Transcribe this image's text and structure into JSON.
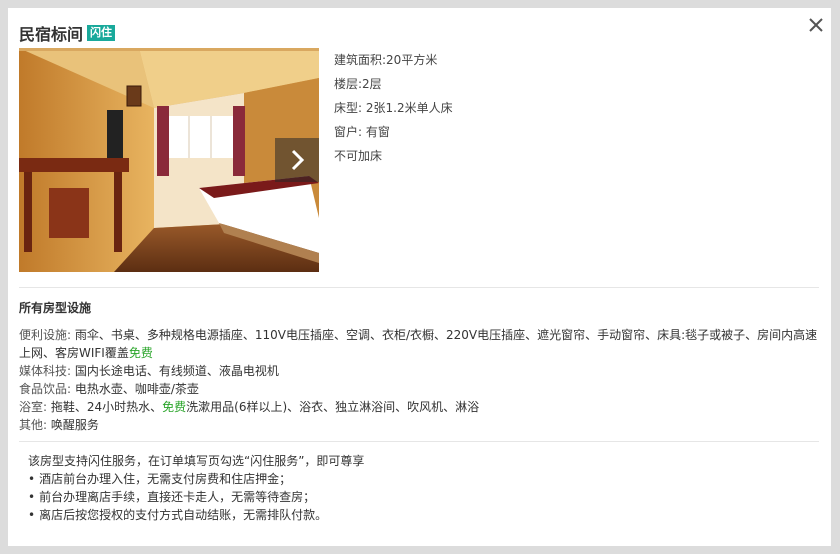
{
  "room": {
    "title": "民宿标间",
    "badge": "闪住"
  },
  "specs": [
    "建筑面积:20平方米",
    "楼层:2层",
    "床型: 2张1.2米单人床",
    "窗户: 有窗",
    "不可加床"
  ],
  "facilities": {
    "title": "所有房型设施",
    "convenience_label": "便利设施:",
    "convenience_text": " 雨伞、书桌、多种规格电源插座、110V电压插座、空调、衣柜/衣橱、220V电压插座、遮光窗帘、手动窗帘、床具:毯子或被子、房间内高速上网、客房WIFI覆盖",
    "convenience_free": "免费",
    "media_label": "媒体科技:",
    "media_text": " 国内长途电话、有线频道、液晶电视机",
    "food_label": "食品饮品:",
    "food_text": " 电热水壶、咖啡壶/茶壶",
    "bath_label": "浴室:",
    "bath_text_1": " 拖鞋、24小时热水、",
    "bath_free": "免费",
    "bath_text_2": "洗漱用品(6样以上)、浴衣、独立淋浴间、吹风机、淋浴",
    "other_label": "其他:",
    "other_text": " 唤醒服务"
  },
  "notice": {
    "intro": "该房型支持闪住服务，在订单填写页勾选“闪住服务”，即可尊享",
    "bullet": "•",
    "items": [
      "酒店前台办理入住，无需支付房费和住店押金；",
      "前台办理离店手续，直接还卡走人，无需等待查房；",
      "离店后按您授权的支付方式自动结账，无需排队付款。"
    ]
  },
  "colors": {
    "badge": "#19a99b",
    "free": "#2aa52a"
  },
  "icons": {
    "close": "close-icon",
    "next": "chevron-right-icon"
  }
}
